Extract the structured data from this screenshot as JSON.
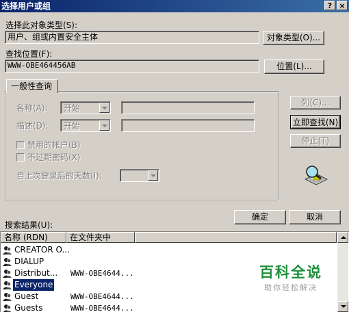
{
  "window": {
    "title": "选择用户或组",
    "help_glyph": "?",
    "close_glyph": "×"
  },
  "object_type": {
    "label": "选择此对象类型(S):",
    "value": "用户、组或内置安全主体",
    "button": "对象类型(O)..."
  },
  "location": {
    "label": "查找位置(F):",
    "value": "WWW-OBE464456AB",
    "button": "位置(L)..."
  },
  "query": {
    "tab": "一般性查询",
    "name_label": "名称(A):",
    "name_mode": "开始",
    "desc_label": "描述(D):",
    "desc_mode": "开始",
    "disabled_accounts": "禁用的帐户(B)",
    "non_expiring": "不过期密码(X)",
    "days_label": "自上次登录后的天数(I):"
  },
  "side_buttons": {
    "columns": "列(C)...",
    "find_now": "立即查找(N)",
    "stop": "停止(T)"
  },
  "ok": "确定",
  "cancel": "取消",
  "results": {
    "label": "搜索结果(U):",
    "columns": [
      "名称 (RDN)",
      "在文件夹中"
    ],
    "rows": [
      {
        "name": "CREATOR O...",
        "folder": ""
      },
      {
        "name": "DIALUP",
        "folder": ""
      },
      {
        "name": "Distribut...",
        "folder": "WWW-OBE4644..."
      },
      {
        "name": "Everyone",
        "folder": ""
      },
      {
        "name": "Guest",
        "folder": "WWW-OBE4644..."
      },
      {
        "name": "Guests",
        "folder": "WWW-OBE4644..."
      }
    ],
    "selected_index": 3
  },
  "watermark": {
    "main": "百科全说",
    "sub": "助你轻松解决"
  }
}
